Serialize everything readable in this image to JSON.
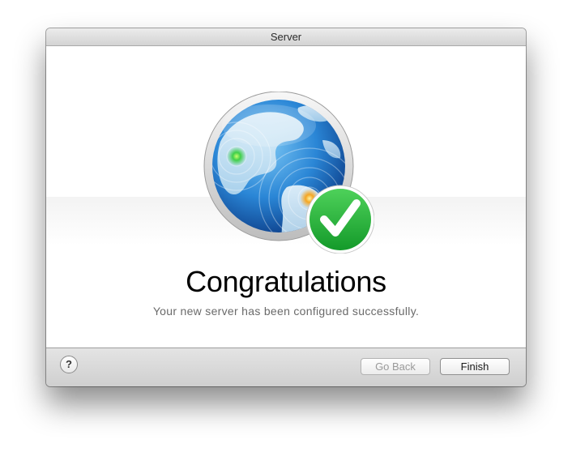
{
  "window": {
    "title": "Server"
  },
  "hero": {
    "image": "server-globe-icon",
    "badge": "checkmark-badge-icon"
  },
  "message": {
    "headline": "Congratulations",
    "subtext": "Your new server has been configured successfully."
  },
  "footer": {
    "help_label": "?",
    "back_label": "Go Back",
    "finish_label": "Finish"
  },
  "colors": {
    "badge_green": "#22b33a",
    "globe_blue": "#2a78c8"
  }
}
